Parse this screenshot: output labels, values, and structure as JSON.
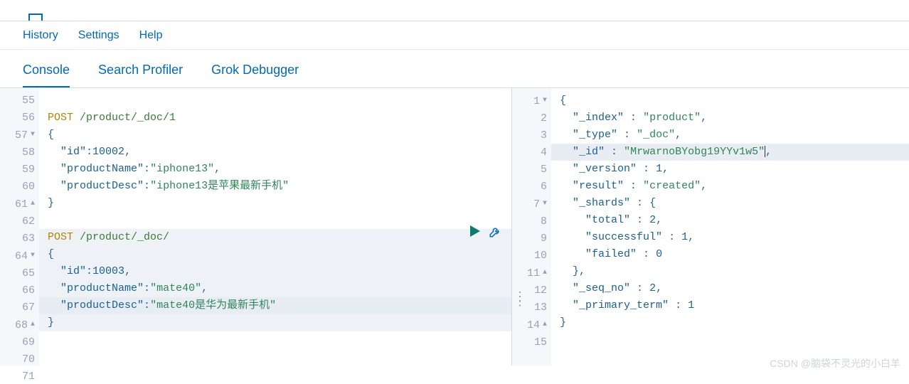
{
  "menu": {
    "history": "History",
    "settings": "Settings",
    "help": "Help"
  },
  "tabs": {
    "console": "Console",
    "searchProfiler": "Search Profiler",
    "grokDebugger": "Grok Debugger"
  },
  "request": {
    "ln55": "55",
    "ln56": "56",
    "ln57": "57",
    "ln58": "58",
    "ln59": "59",
    "ln60": "60",
    "ln61": "61",
    "ln62": "62",
    "ln63": "63",
    "ln64": "64",
    "ln65": "65",
    "ln66": "66",
    "ln67": "67",
    "ln68": "68",
    "ln69": "69",
    "ln70": "70",
    "ln71": "71",
    "method1": "POST",
    "path1": "/product/_doc/1",
    "brace_open": "{",
    "brace_close": "}",
    "r1_key_id": "\"id\"",
    "r1_val_id": "10002",
    "r1_key_name": "\"productName\"",
    "r1_val_name": "\"iphone13\"",
    "r1_key_desc": "\"productDesc\"",
    "r1_val_desc": "\"iphone13是苹果最新手机\"",
    "method2": "POST",
    "path2": "/product/_doc/",
    "r2_key_id": "\"id\"",
    "r2_val_id": "10003",
    "r2_key_name": "\"productName\"",
    "r2_val_name": "\"mate40\"",
    "r2_key_desc": "\"productDesc\"",
    "r2_val_desc": "\"mate40是华为最新手机\""
  },
  "response": {
    "ln1": "1",
    "ln2": "2",
    "ln3": "3",
    "ln4": "4",
    "ln5": "5",
    "ln6": "6",
    "ln7": "7",
    "ln8": "8",
    "ln9": "9",
    "ln10": "10",
    "ln11": "11",
    "ln12": "12",
    "ln13": "13",
    "ln14": "14",
    "ln15": "15",
    "brace_open": "{",
    "brace_close": "}",
    "k_index": "\"_index\"",
    "v_index": "\"product\"",
    "k_type": "\"_type\"",
    "v_type": "\"_doc\"",
    "k_id": "\"_id\"",
    "v_id": "\"MrwarnoBYobg19YYv1w5\"",
    "k_version": "\"_version\"",
    "v_version": "1",
    "k_result": "\"result\"",
    "v_result": "\"created\"",
    "k_shards": "\"_shards\"",
    "k_total": "\"total\"",
    "v_total": "2",
    "k_successful": "\"successful\"",
    "v_successful": "1",
    "k_failed": "\"failed\"",
    "v_failed": "0",
    "k_seqno": "\"_seq_no\"",
    "v_seqno": "2",
    "k_primary": "\"_primary_term\"",
    "v_primary": "1"
  },
  "watermark": "CSDN @脑袋不灵光的小白羊"
}
